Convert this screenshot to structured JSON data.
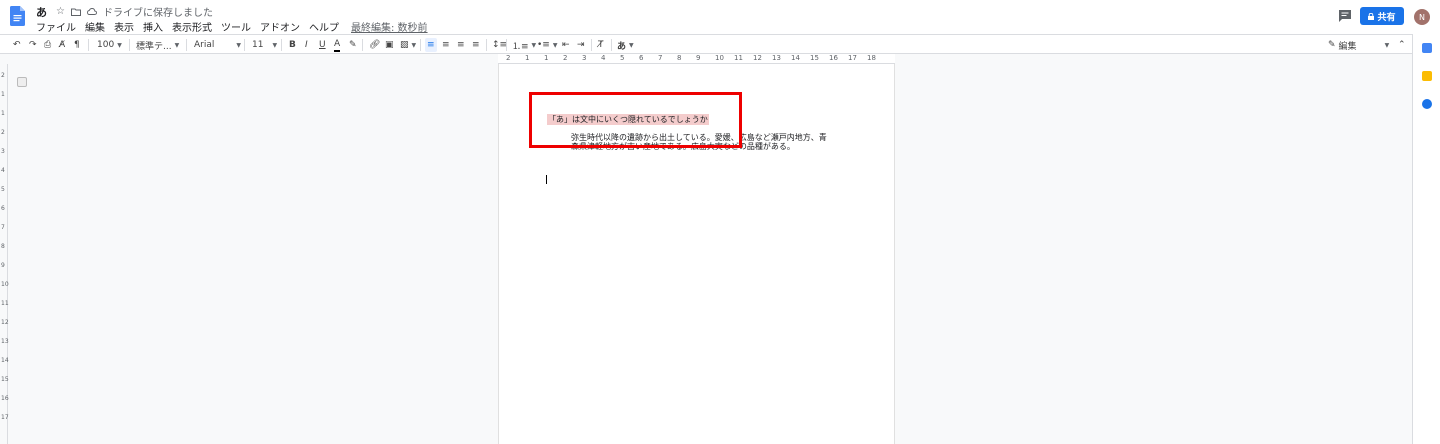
{
  "document": {
    "title": "あ",
    "save_status": "ドライブに保存しました",
    "last_edit": "最終編集: 数秒前"
  },
  "menu": [
    "ファイル",
    "編集",
    "表示",
    "挿入",
    "表示形式",
    "ツール",
    "アドオン",
    "ヘルプ"
  ],
  "toolbar": {
    "zoom": "100",
    "style": "標準テ...",
    "font": "Arial",
    "font_size": "11",
    "bold": "B",
    "italic": "I",
    "underline": "U",
    "text_color": "A",
    "input_tool": "あ",
    "mode": "編集"
  },
  "header": {
    "share_label": "共有",
    "avatar_letter": "N"
  },
  "ruler": {
    "top_ticks": [
      "2",
      "1",
      "1",
      "2",
      "3",
      "4",
      "5",
      "6",
      "7",
      "8",
      "9",
      "10",
      "11",
      "12",
      "13",
      "14",
      "15",
      "16",
      "17",
      "18"
    ],
    "left_ticks": [
      "2",
      "1",
      "1",
      "2",
      "3",
      "4",
      "5",
      "6",
      "7",
      "8",
      "9",
      "10",
      "11",
      "12",
      "13",
      "14",
      "15",
      "16",
      "17"
    ]
  },
  "content": {
    "heading": "「あ」は文中にいくつ隠れているでしょうか",
    "body": "弥生時代以降の遺跡から出土している。愛媛、広島など瀬戸内地方、青森県津軽地方が古い産地である。広島大実などの品種がある。"
  },
  "colors": {
    "accent": "#1a73e8",
    "annotation": "#ee0000",
    "highlight": "#f4cccc"
  }
}
